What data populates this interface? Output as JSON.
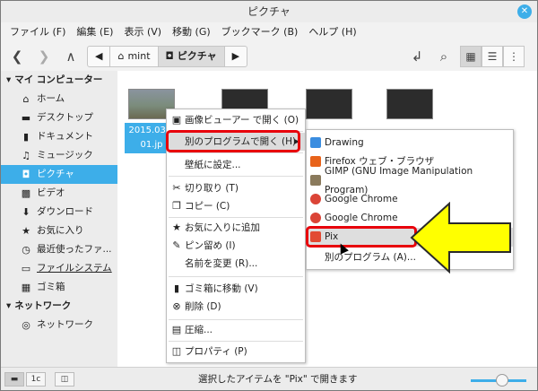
{
  "window": {
    "title": "ピクチャ",
    "close_icon": "close-icon"
  },
  "menubar": {
    "items": [
      "ファイル (F)",
      "編集 (E)",
      "表示 (V)",
      "移動 (G)",
      "ブックマーク (B)",
      "ヘルプ (H)"
    ]
  },
  "toolbar": {
    "back": "❮",
    "forward": "❯",
    "up": "∧",
    "path": [
      {
        "label": "◀",
        "icon": ""
      },
      {
        "label": "mint",
        "icon": "⌂"
      },
      {
        "label": "ピクチャ",
        "icon": "◘"
      },
      {
        "label": "▶",
        "icon": ""
      }
    ],
    "open_terminal": "↲",
    "search": "⌕",
    "view_icons": "▦",
    "view_list": "☰",
    "view_compact": "⋮"
  },
  "sidebar": {
    "sections": [
      {
        "title": "マイ コンピューター",
        "items": [
          {
            "label": "ホーム",
            "icon": "⌂"
          },
          {
            "label": "デスクトップ",
            "icon": "▬"
          },
          {
            "label": "ドキュメント",
            "icon": "▮"
          },
          {
            "label": "ミュージック",
            "icon": "♫"
          },
          {
            "label": "ピクチャ",
            "icon": "◘",
            "selected": true
          },
          {
            "label": "ビデオ",
            "icon": "▩"
          },
          {
            "label": "ダウンロード",
            "icon": "⬇"
          },
          {
            "label": "お気に入り",
            "icon": "★"
          },
          {
            "label": "最近使ったファ...",
            "icon": "◷"
          },
          {
            "label": "ファイルシステム",
            "icon": "▭"
          },
          {
            "label": "ゴミ箱",
            "icon": "▦"
          }
        ]
      },
      {
        "title": "ネットワーク",
        "items": [
          {
            "label": "ネットワーク",
            "icon": "◎"
          }
        ]
      }
    ]
  },
  "files": {
    "selected_name": "2015.03.1\n01.jp"
  },
  "context_menu": {
    "items": [
      {
        "label": "画像ビューアー で開く (O)",
        "icon": "▣"
      },
      {
        "label": "別のプログラムで開く (H)",
        "icon": "",
        "submenu": "▶",
        "highlighted": true
      },
      {
        "label": "壁紙に設定...",
        "icon": ""
      },
      {
        "label": "切り取り (T)",
        "icon": "✂"
      },
      {
        "label": "コピー (C)",
        "icon": "❐"
      },
      {
        "label": "お気に入りに追加",
        "icon": "★"
      },
      {
        "label": "ピン留め (I)",
        "icon": "✎"
      },
      {
        "label": "名前を変更 (R)...",
        "icon": ""
      },
      {
        "label": "ゴミ箱に移動 (V)",
        "icon": "▮"
      },
      {
        "label": "削除 (D)",
        "icon": "⊗"
      },
      {
        "label": "圧縮...",
        "icon": "▤"
      },
      {
        "label": "プロパティ (P)",
        "icon": "◫"
      }
    ]
  },
  "submenu": {
    "items": [
      {
        "label": "Drawing",
        "color": "#3a8de0"
      },
      {
        "label": "Firefox ウェブ・ブラウザ",
        "color": "#e8631b"
      },
      {
        "label": "GIMP (GNU Image Manipulation Program)",
        "color": "#8a7a5c"
      },
      {
        "label": "Google Chrome",
        "color": "#db4437"
      },
      {
        "label": "Google Chrome",
        "color": "#db4437"
      },
      {
        "label": "Pix",
        "color": "#e24a33",
        "highlighted": true
      },
      {
        "label": "別のプログラム (A)...",
        "color": ""
      }
    ]
  },
  "statusbar": {
    "status_text": "選択したアイテムを \"Pix\" で開きます",
    "btn_places": "▬",
    "btn_tree": "1c",
    "btn_hide": "◫"
  },
  "colors": {
    "accent": "#3daee9",
    "highlight_box": "#e8000b",
    "arrow_fill": "#ffff00"
  }
}
